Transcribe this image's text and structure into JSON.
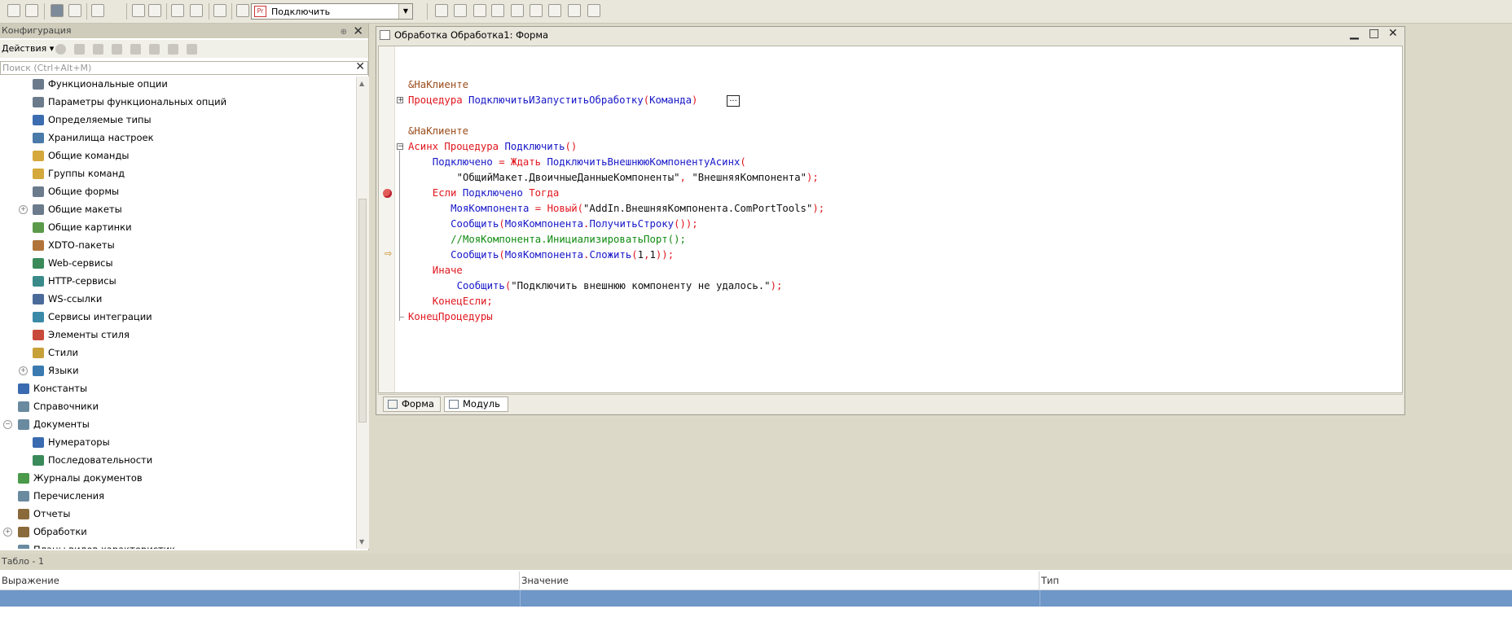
{
  "toolbar": {
    "combo_value": "Подключить",
    "combo_icon_text": "Pr"
  },
  "left_panel": {
    "title": "Конфигурация",
    "actions_label": "Действия",
    "search_placeholder": "Поиск (Ctrl+Alt+M)",
    "tree": [
      {
        "label": "Функциональные опции",
        "level": 2,
        "icon_color": "#6b7b8c"
      },
      {
        "label": "Параметры функциональных опций",
        "level": 2,
        "icon_color": "#6b7b8c"
      },
      {
        "label": "Определяемые типы",
        "level": 2,
        "icon_color": "#3c6db0"
      },
      {
        "label": "Хранилища настроек",
        "level": 2,
        "icon_color": "#4a7aa8"
      },
      {
        "label": "Общие команды",
        "level": 2,
        "icon_color": "#d4a83a"
      },
      {
        "label": "Группы команд",
        "level": 2,
        "icon_color": "#d4a83a"
      },
      {
        "label": "Общие формы",
        "level": 2,
        "icon_color": "#6b7b8c"
      },
      {
        "label": "Общие макеты",
        "level": 2,
        "icon_color": "#6b7b8c",
        "expander": "+"
      },
      {
        "label": "Общие картинки",
        "level": 2,
        "icon_color": "#5a9a4a"
      },
      {
        "label": "XDTO-пакеты",
        "level": 2,
        "icon_color": "#b0743a"
      },
      {
        "label": "Web-сервисы",
        "level": 2,
        "icon_color": "#3a8a5a"
      },
      {
        "label": "HTTP-сервисы",
        "level": 2,
        "icon_color": "#3a8a8a"
      },
      {
        "label": "WS-ссылки",
        "level": 2,
        "icon_color": "#4a6a9a"
      },
      {
        "label": "Сервисы интеграции",
        "level": 2,
        "icon_color": "#3a8aa8"
      },
      {
        "label": "Элементы стиля",
        "level": 2,
        "icon_color": "#c84a3a"
      },
      {
        "label": "Стили",
        "level": 2,
        "icon_color": "#c8a03a"
      },
      {
        "label": "Языки",
        "level": 2,
        "icon_color": "#3a7ab0",
        "expander": "+"
      },
      {
        "label": "Константы",
        "level": 1,
        "icon_color": "#3a6ab0"
      },
      {
        "label": "Справочники",
        "level": 1,
        "icon_color": "#6a8aa0"
      },
      {
        "label": "Документы",
        "level": 1,
        "icon_color": "#6a8aa0",
        "expander": "-"
      },
      {
        "label": "Нумераторы",
        "level": 2,
        "icon_color": "#3a6ab0"
      },
      {
        "label": "Последовательности",
        "level": 2,
        "icon_color": "#3a8a5a"
      },
      {
        "label": "Журналы документов",
        "level": 1,
        "icon_color": "#4a9a4a"
      },
      {
        "label": "Перечисления",
        "level": 1,
        "icon_color": "#6a8aa0"
      },
      {
        "label": "Отчеты",
        "level": 1,
        "icon_color": "#8a6a3a"
      },
      {
        "label": "Обработки",
        "level": 1,
        "icon_color": "#8a6a3a",
        "expander": "+"
      },
      {
        "label": "Планы видов характеристик",
        "level": 1,
        "icon_color": "#6a8aa0"
      }
    ]
  },
  "editor_window": {
    "title": "Обработка Обработка1: Форма",
    "tabs": [
      {
        "label": "Форма"
      },
      {
        "label": "Модуль"
      }
    ],
    "lines": [
      {
        "row": 0,
        "indent": 0,
        "tokens": []
      },
      {
        "row": 1,
        "indent": 0,
        "tokens": []
      },
      {
        "row": 2,
        "indent": 0,
        "tokens": [
          {
            "t": "&НаКлиенте",
            "c": "dir"
          }
        ]
      },
      {
        "row": 3,
        "indent": 0,
        "tokens": [
          {
            "t": "Процедура ",
            "c": "kw"
          },
          {
            "t": "ПодключитьИЗапуститьОбработку",
            "c": "id"
          },
          {
            "t": "(",
            "c": "kw"
          },
          {
            "t": "Команда",
            "c": "id"
          },
          {
            "t": ")",
            "c": "kw"
          }
        ]
      },
      {
        "row": 4,
        "indent": 0,
        "tokens": []
      },
      {
        "row": 5,
        "indent": 0,
        "tokens": [
          {
            "t": "&НаКлиенте",
            "c": "dir"
          }
        ]
      },
      {
        "row": 6,
        "indent": 0,
        "tokens": [
          {
            "t": "Асинх Процедура ",
            "c": "kw"
          },
          {
            "t": "Подключить",
            "c": "id"
          },
          {
            "t": "()",
            "c": "kw"
          }
        ]
      },
      {
        "row": 7,
        "indent": 4,
        "tokens": [
          {
            "t": "Подключено ",
            "c": "id"
          },
          {
            "t": "= Ждать ",
            "c": "kw"
          },
          {
            "t": "ПодключитьВнешнююКомпонентуАсинх",
            "c": "id"
          },
          {
            "t": "(",
            "c": "kw"
          }
        ]
      },
      {
        "row": 8,
        "indent": 8,
        "tokens": [
          {
            "t": "\"ОбщийМакет.ДвоичныеДанныеКомпоненты\"",
            "c": "str"
          },
          {
            "t": ", ",
            "c": "kw"
          },
          {
            "t": "\"ВнешняяКомпонента\"",
            "c": "str"
          },
          {
            "t": ");",
            "c": "kw"
          }
        ]
      },
      {
        "row": 9,
        "indent": 4,
        "tokens": [
          {
            "t": "Если ",
            "c": "kw"
          },
          {
            "t": "Подключено ",
            "c": "id"
          },
          {
            "t": "Тогда",
            "c": "kw"
          }
        ]
      },
      {
        "row": 10,
        "indent": 7,
        "tokens": [
          {
            "t": "МояКомпонента ",
            "c": "id"
          },
          {
            "t": "= Новый(",
            "c": "kw"
          },
          {
            "t": "\"AddIn.ВнешняяКомпонента.ComPortTools\"",
            "c": "str"
          },
          {
            "t": ");",
            "c": "kw"
          }
        ]
      },
      {
        "row": 11,
        "indent": 7,
        "tokens": [
          {
            "t": "Сообщить",
            "c": "id"
          },
          {
            "t": "(",
            "c": "kw"
          },
          {
            "t": "МояКомпонента",
            "c": "id"
          },
          {
            "t": ".",
            "c": "kw"
          },
          {
            "t": "ПолучитьСтроку",
            "c": "id"
          },
          {
            "t": "());",
            "c": "kw"
          }
        ]
      },
      {
        "row": 12,
        "indent": 7,
        "tokens": [
          {
            "t": "//МояКомпонента.ИнициализироватьПорт();",
            "c": "cm"
          }
        ]
      },
      {
        "row": 13,
        "indent": 7,
        "tokens": [
          {
            "t": "Сообщить",
            "c": "id"
          },
          {
            "t": "(",
            "c": "kw"
          },
          {
            "t": "МояКомпонента",
            "c": "id"
          },
          {
            "t": ".",
            "c": "kw"
          },
          {
            "t": "Сложить",
            "c": "id"
          },
          {
            "t": "(",
            "c": "kw"
          },
          {
            "t": "1",
            "c": "str"
          },
          {
            "t": ",",
            "c": "kw"
          },
          {
            "t": "1",
            "c": "str"
          },
          {
            "t": "));",
            "c": "kw"
          }
        ]
      },
      {
        "row": 14,
        "indent": 4,
        "tokens": [
          {
            "t": "Иначе",
            "c": "kw"
          }
        ]
      },
      {
        "row": 15,
        "indent": 8,
        "tokens": [
          {
            "t": "Сообщить",
            "c": "id"
          },
          {
            "t": "(",
            "c": "kw"
          },
          {
            "t": "\"Подключить внешнюю компоненту не удалось.\"",
            "c": "str"
          },
          {
            "t": ");",
            "c": "kw"
          }
        ]
      },
      {
        "row": 16,
        "indent": 4,
        "tokens": [
          {
            "t": "КонецЕсли;",
            "c": "kw"
          }
        ]
      },
      {
        "row": 17,
        "indent": 0,
        "tokens": [
          {
            "t": "КонецПроцедуры",
            "c": "kw"
          }
        ]
      }
    ],
    "collapsed_marker": "..."
  },
  "bottom_panel": {
    "title": "Табло - 1",
    "columns": [
      "Выражение",
      "Значение",
      "Тип"
    ]
  }
}
